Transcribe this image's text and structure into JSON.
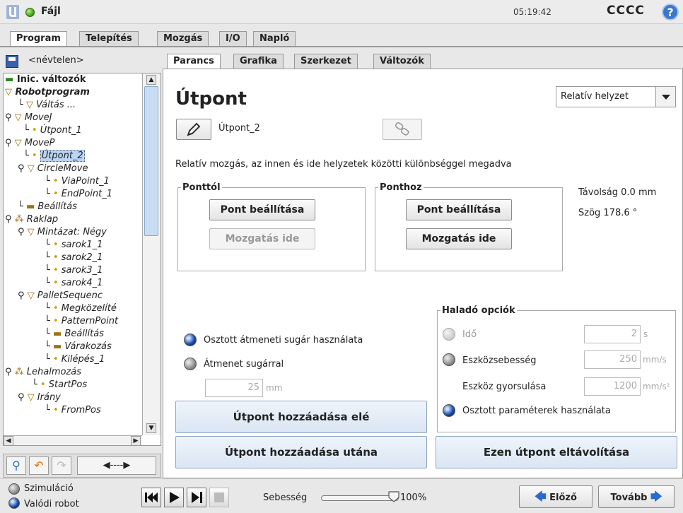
{
  "topbar": {
    "file_label": "Fájl",
    "clock": "05:19:42",
    "robot_name": "CCCC",
    "help_glyph": "?"
  },
  "main_tabs": [
    "Program",
    "Telepítés",
    "Mozgás",
    "I/O",
    "Napló"
  ],
  "left": {
    "program_name": "<névtelen>",
    "tree": [
      "Inic. változók",
      "Robotprogram",
      "Váltás ...",
      "MoveJ",
      "Útpont_1",
      "MoveP",
      "Útpont_2",
      "CircleMove",
      "ViaPoint_1",
      "EndPoint_1",
      "Beállítás",
      "Raklap",
      "Mintázat: Négy",
      "sarok1_1",
      "sarok2_1",
      "sarok3_1",
      "sarok4_1",
      "PalletSequenc",
      "Megközelíté",
      "PatternPoint",
      "Beállítás",
      "Várakozás",
      "Kilépés_1",
      "Lehalmozás",
      "StartPos",
      "Irány",
      "FromPos"
    ]
  },
  "sub_tabs": [
    "Parancs",
    "Grafika",
    "Szerkezet",
    "Változók"
  ],
  "content": {
    "title": "Útpont",
    "mode_select": "Relatív helyzet",
    "waypoint_name": "Útpont_2",
    "description": "Relatív mozgás, az innen és ide helyzetek közötti különbséggel megadva",
    "from_group": {
      "legend": "Ponttól",
      "set_label": "Pont beállítása",
      "move_label": "Mozgatás ide"
    },
    "to_group": {
      "legend": "Ponthoz",
      "set_label": "Pont beállítása",
      "move_label": "Mozgatás ide"
    },
    "distance": "Távolság 0.0 mm",
    "angle": "Szög 178.6 °",
    "blend": {
      "shared_label": "Osztott átmeneti sugár használata",
      "radius_label": "Átmenet sugárral",
      "radius_value": "25",
      "radius_unit": "mm"
    },
    "advanced": {
      "legend": "Haladó opciók",
      "time_label": "Idő",
      "time_value": "2",
      "time_unit": "s",
      "speed_label": "Eszközsebesség",
      "speed_value": "250",
      "speed_unit": "mm/s",
      "accel_label": "Eszköz gyorsulása",
      "accel_value": "1200",
      "accel_unit": "mm/s²",
      "shared_label": "Osztott paraméterek használata"
    },
    "add_before": "Útpont hozzáadása elé",
    "add_after": "Útpont hozzáadása utána",
    "remove": "Ezen útpont eltávolítása"
  },
  "bottom": {
    "simulation": "Szimuláció",
    "real_robot": "Valódi robot",
    "speed_label": "Sebesség",
    "speed_value": "100%",
    "speed_fraction": 1.0,
    "prev": "Előző",
    "next": "Tovább"
  },
  "colors": {
    "accent_blue": "#3b78c8",
    "status_green": "#3a9a14",
    "button_blue_bg": "#dae6f3"
  }
}
